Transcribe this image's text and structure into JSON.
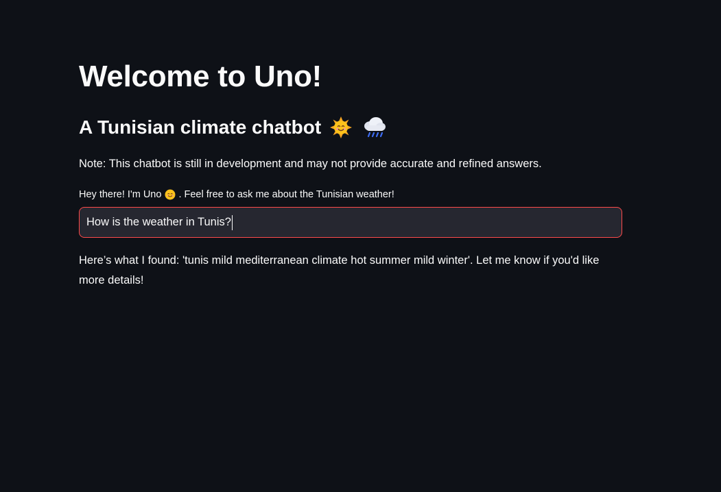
{
  "header": {
    "title": "Welcome to Uno!",
    "subtitle": "A Tunisian climate chatbot",
    "subtitle_icons": [
      "sun-with-face-icon",
      "cloud-with-rain-icon"
    ]
  },
  "note": "Note: This chatbot is still in development and may not provide accurate and refined answers.",
  "chat": {
    "label_before": "Hey there! I'm Uno",
    "label_icon": "smiling-face-icon",
    "label_after": ". Feel free to ask me about the Tunisian weather!",
    "input_value": "How is the weather in Tunis?",
    "response": "Here’s what I found: 'tunis mild mediterranean climate hot summer mild winter'. Let me know if you'd like more details!"
  },
  "colors": {
    "background": "#0e1117",
    "text": "#fafafa",
    "input_background": "#262730",
    "input_focus_border": "#ff4b4b"
  }
}
